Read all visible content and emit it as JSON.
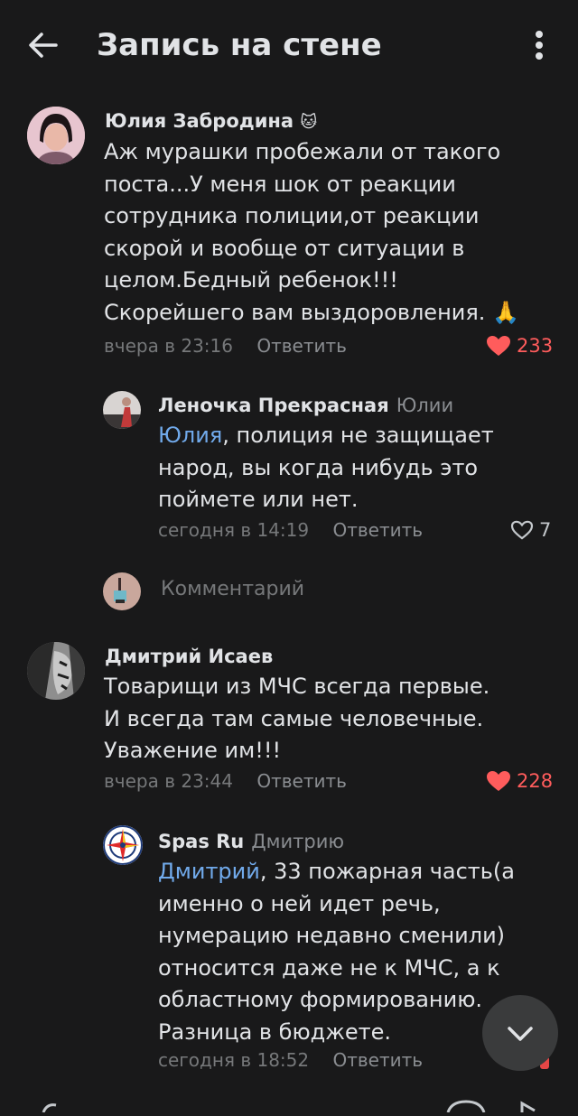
{
  "header": {
    "title": "Запись на стене"
  },
  "comments": [
    {
      "author": "Юлия Забродина",
      "author_emoji": "🐱",
      "text": "Аж мурашки пробежали от такого поста...У меня шок от реакции сотрудника полиции,от реакции скорой и вообще от ситуации в целом.Бедный ребенок!!!Скорейшего вам выздоровления. 🙏",
      "time": "вчера в 23:16",
      "reply_label": "Ответить",
      "likes": "233"
    },
    {
      "author": "Леночка Прекрасная",
      "reply_to": "Юлии",
      "mention": "Юлия",
      "text": ", полиция не защищает народ, вы когда нибудь это поймете или нет.",
      "time": "сегодня в 14:19",
      "reply_label": "Ответить",
      "likes": "7"
    },
    {
      "author": "Дмитрий Исаев",
      "text": "Товарищи из МЧС всегда первые. И всегда там самые человечные. Уважение им!!!",
      "time": "вчера в 23:44",
      "reply_label": "Ответить",
      "likes": "228"
    },
    {
      "author": "Spas Ru",
      "reply_to": "Дмитрию",
      "mention": "Дмитрий",
      "text": ", 33 пожарная часть(а именно о ней идет речь, нумерацию недавно сменили) относится даже не к МЧС, а к областному формированию. Разница в бюджете.",
      "time": "сегодня в 18:52",
      "reply_label": "Ответить"
    }
  ],
  "write_comment": {
    "placeholder": "Комментарий"
  },
  "colors": {
    "background": "#19191a",
    "accent": "#71aaeb",
    "like_active": "#ff5c5c"
  },
  "icons": [
    "back-arrow-icon",
    "more-vertical-icon",
    "heart-filled-icon",
    "heart-outline-icon",
    "chevron-down-icon"
  ]
}
